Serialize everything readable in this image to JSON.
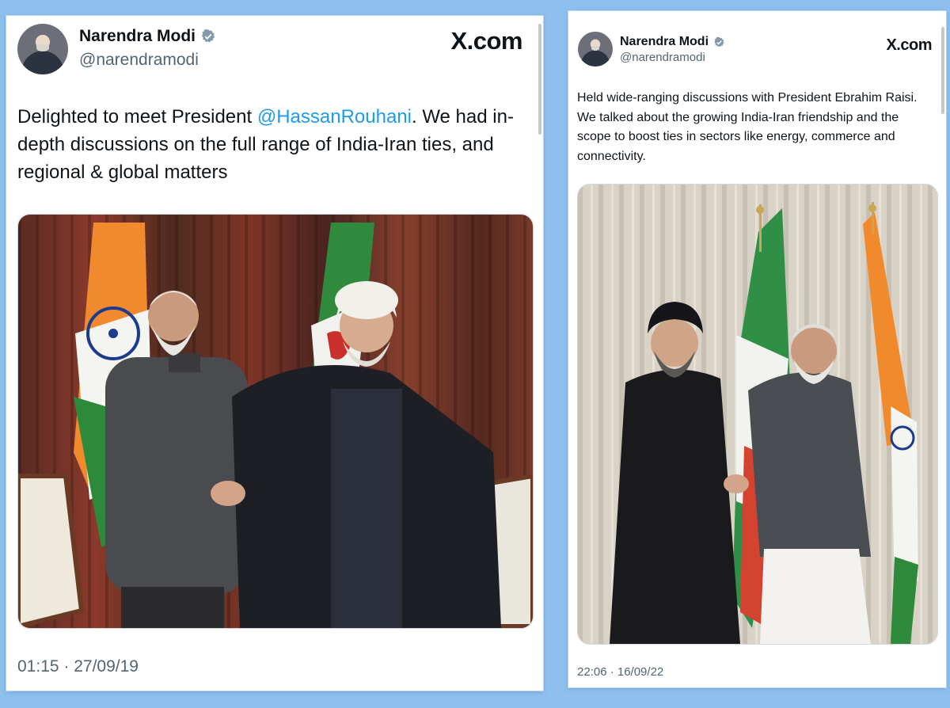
{
  "tweets": [
    {
      "author_name": "Narendra Modi",
      "handle": "@narendramodi",
      "brand": "X.com",
      "text_before": "Delighted to meet President ",
      "mention": "@HassanRouhani",
      "text_after": ". We had in-depth discussions on the full range of India-Iran ties, and regional & global matters",
      "timestamp": "01:15 · 27/09/19"
    },
    {
      "author_name": "Narendra Modi",
      "handle": "@narendramodi",
      "brand": "X.com",
      "text": "Held wide-ranging discussions with President Ebrahim Raisi. We talked about the growing India-Iran friendship and the scope to boost ties in sectors like energy, commerce and connectivity.",
      "timestamp": "22:06 · 16/09/22"
    }
  ],
  "colors": {
    "background": "#8ec0ee",
    "mention": "#1d9bf0",
    "verified": "#829aab",
    "text": "#0f1419",
    "secondary": "#536471"
  },
  "icons": [
    "verified-badge-icon",
    "x-logo"
  ]
}
